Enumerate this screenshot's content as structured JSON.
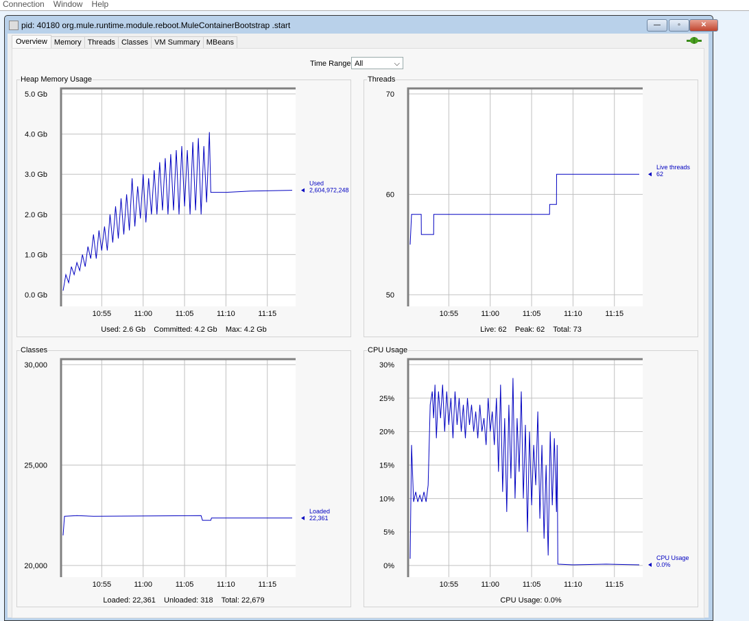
{
  "menu": [
    "Connection",
    "Window",
    "Help"
  ],
  "window": {
    "title": "pid: 40180 org.mule.runtime.module.reboot.MuleContainerBootstrap .start",
    "minimize": "—",
    "maximize": "▫",
    "close": "✕"
  },
  "tabs": [
    "Overview",
    "Memory",
    "Threads",
    "Classes",
    "VM Summary",
    "MBeans"
  ],
  "active_tab": "Overview",
  "time_range": {
    "label": "Time Range:",
    "value": "All"
  },
  "colors": {
    "series": "#0000c0",
    "grid": "#c0c0c0",
    "frame": "#808080"
  },
  "chart_data": [
    {
      "id": "heap",
      "type": "line",
      "title": "Heap Memory Usage",
      "ylim": [
        0,
        5
      ],
      "yticks": [
        0,
        1,
        2,
        3,
        4,
        5
      ],
      "ytick_labels": [
        "0.0 Gb",
        "1.0 Gb",
        "2.0 Gb",
        "3.0 Gb",
        "4.0 Gb",
        "5.0 Gb"
      ],
      "xlim": [
        "10:50:05",
        "11:18:25"
      ],
      "xtick_labels": [
        "10:55",
        "11:00",
        "11:05",
        "11:10",
        "11:15"
      ],
      "grid": true,
      "legend": {
        "label": "Used",
        "value": "2,604,972,248"
      },
      "footer": "Used: 2.6 Gb    Committed: 4.2 Gb    Max: 4.2 Gb",
      "points": [
        [
          "10:50:20",
          0.1
        ],
        [
          "10:50:40",
          0.5
        ],
        [
          "10:51:00",
          0.3
        ],
        [
          "10:51:20",
          0.7
        ],
        [
          "10:51:40",
          0.5
        ],
        [
          "10:52:00",
          0.8
        ],
        [
          "10:52:20",
          0.6
        ],
        [
          "10:52:40",
          1.0
        ],
        [
          "10:53:00",
          0.7
        ],
        [
          "10:53:20",
          1.2
        ],
        [
          "10:53:40",
          0.9
        ],
        [
          "10:54:00",
          1.5
        ],
        [
          "10:54:20",
          0.9
        ],
        [
          "10:54:40",
          1.6
        ],
        [
          "10:55:00",
          1.1
        ],
        [
          "10:55:20",
          1.7
        ],
        [
          "10:55:40",
          1.1
        ],
        [
          "10:56:00",
          2.0
        ],
        [
          "10:56:20",
          1.3
        ],
        [
          "10:56:40",
          2.2
        ],
        [
          "10:57:00",
          1.4
        ],
        [
          "10:57:20",
          2.4
        ],
        [
          "10:57:40",
          1.5
        ],
        [
          "10:58:00",
          2.5
        ],
        [
          "10:58:20",
          1.6
        ],
        [
          "10:58:40",
          2.9
        ],
        [
          "10:59:00",
          1.7
        ],
        [
          "10:59:20",
          2.7
        ],
        [
          "10:59:40",
          1.9
        ],
        [
          "11:00:00",
          3.0
        ],
        [
          "11:00:20",
          1.8
        ],
        [
          "11:00:40",
          2.9
        ],
        [
          "11:01:00",
          2.0
        ],
        [
          "11:01:20",
          3.1
        ],
        [
          "11:01:40",
          2.0
        ],
        [
          "11:02:00",
          3.3
        ],
        [
          "11:02:20",
          2.1
        ],
        [
          "11:02:40",
          3.4
        ],
        [
          "11:03:00",
          2.0
        ],
        [
          "11:03:20",
          3.5
        ],
        [
          "11:03:40",
          2.1
        ],
        [
          "11:04:00",
          3.6
        ],
        [
          "11:04:20",
          2.0
        ],
        [
          "11:04:40",
          3.7
        ],
        [
          "11:05:00",
          2.2
        ],
        [
          "11:05:20",
          3.6
        ],
        [
          "11:05:40",
          2.0
        ],
        [
          "11:06:00",
          3.8
        ],
        [
          "11:06:20",
          2.1
        ],
        [
          "11:06:40",
          3.9
        ],
        [
          "11:07:00",
          2.0
        ],
        [
          "11:07:20",
          3.7
        ],
        [
          "11:07:40",
          2.3
        ],
        [
          "11:08:00",
          4.05
        ],
        [
          "11:08:10",
          2.55
        ],
        [
          "11:10:00",
          2.55
        ],
        [
          "11:13:00",
          2.58
        ],
        [
          "11:18:00",
          2.6
        ]
      ]
    },
    {
      "id": "threads",
      "type": "line",
      "title": "Threads",
      "ylim": [
        50,
        70
      ],
      "yticks": [
        50,
        60,
        70
      ],
      "ytick_labels": [
        "50",
        "60",
        "70"
      ],
      "xlim": [
        "10:50:05",
        "11:18:25"
      ],
      "xtick_labels": [
        "10:55",
        "11:00",
        "11:05",
        "11:10",
        "11:15"
      ],
      "grid": true,
      "legend": {
        "label": "Live threads",
        "value": "62"
      },
      "footer": "Live: 62    Peak: 62    Total: 73",
      "points": [
        [
          "10:50:20",
          55
        ],
        [
          "10:50:30",
          58
        ],
        [
          "10:51:40",
          58
        ],
        [
          "10:51:41",
          56
        ],
        [
          "10:53:10",
          56
        ],
        [
          "10:53:11",
          58
        ],
        [
          "11:07:10",
          58
        ],
        [
          "11:07:11",
          59
        ],
        [
          "11:08:00",
          59
        ],
        [
          "11:08:01",
          62
        ],
        [
          "11:18:00",
          62
        ]
      ]
    },
    {
      "id": "classes",
      "type": "line",
      "title": "Classes",
      "ylim": [
        20000,
        30000
      ],
      "yticks": [
        20000,
        25000,
        30000
      ],
      "ytick_labels": [
        "20,000",
        "25,000",
        "30,000"
      ],
      "xlim": [
        "10:50:05",
        "11:18:25"
      ],
      "xtick_labels": [
        "10:55",
        "11:00",
        "11:05",
        "11:10",
        "11:15"
      ],
      "grid": true,
      "legend": {
        "label": "Loaded",
        "value": "22,361"
      },
      "footer": "Loaded: 22,361    Unloaded: 318    Total: 22,679",
      "points": [
        [
          "10:50:20",
          21500
        ],
        [
          "10:50:30",
          22450
        ],
        [
          "10:52:00",
          22480
        ],
        [
          "10:54:00",
          22450
        ],
        [
          "11:07:00",
          22480
        ],
        [
          "11:07:10",
          22250
        ],
        [
          "11:08:10",
          22250
        ],
        [
          "11:08:15",
          22361
        ],
        [
          "11:18:00",
          22361
        ]
      ]
    },
    {
      "id": "cpu",
      "type": "line",
      "title": "CPU Usage",
      "ylim": [
        0,
        30
      ],
      "yticks": [
        0,
        5,
        10,
        15,
        20,
        25,
        30
      ],
      "ytick_labels": [
        "0%",
        "5%",
        "10%",
        "15%",
        "20%",
        "25%",
        "30%"
      ],
      "xlim": [
        "10:50:05",
        "11:18:25"
      ],
      "xtick_labels": [
        "10:55",
        "11:00",
        "11:05",
        "11:10",
        "11:15"
      ],
      "grid": true,
      "legend": {
        "label": "CPU Usage",
        "value": "0.0%"
      },
      "footer": "CPU Usage: 0.0%",
      "points": [
        [
          "10:50:20",
          1
        ],
        [
          "10:50:30",
          18
        ],
        [
          "10:50:45",
          9.5
        ],
        [
          "10:51:00",
          11
        ],
        [
          "10:51:15",
          9.5
        ],
        [
          "10:51:30",
          10.5
        ],
        [
          "10:51:45",
          9.5
        ],
        [
          "10:52:00",
          11
        ],
        [
          "10:52:15",
          9.5
        ],
        [
          "10:52:30",
          12
        ],
        [
          "10:52:45",
          24
        ],
        [
          "10:53:00",
          26
        ],
        [
          "10:53:10",
          22
        ],
        [
          "10:53:20",
          27
        ],
        [
          "10:53:30",
          19
        ],
        [
          "10:53:45",
          26
        ],
        [
          "10:54:00",
          22
        ],
        [
          "10:54:15",
          27
        ],
        [
          "10:54:30",
          20
        ],
        [
          "10:54:45",
          26
        ],
        [
          "10:55:00",
          21
        ],
        [
          "10:55:15",
          25
        ],
        [
          "10:55:30",
          19
        ],
        [
          "10:55:45",
          26
        ],
        [
          "10:56:00",
          21
        ],
        [
          "10:56:15",
          25
        ],
        [
          "10:56:30",
          20
        ],
        [
          "10:56:45",
          24
        ],
        [
          "10:57:00",
          19
        ],
        [
          "10:57:15",
          25
        ],
        [
          "10:57:30",
          21
        ],
        [
          "10:57:45",
          24
        ],
        [
          "10:58:00",
          20
        ],
        [
          "10:58:15",
          23
        ],
        [
          "10:58:30",
          19
        ],
        [
          "10:58:45",
          24
        ],
        [
          "10:59:00",
          20
        ],
        [
          "10:59:15",
          22
        ],
        [
          "10:59:30",
          18
        ],
        [
          "10:59:45",
          25
        ],
        [
          "11:00:00",
          20
        ],
        [
          "11:00:15",
          23
        ],
        [
          "11:00:30",
          18
        ],
        [
          "11:00:45",
          25
        ],
        [
          "11:01:00",
          14
        ],
        [
          "11:01:15",
          27
        ],
        [
          "11:01:30",
          11
        ],
        [
          "11:01:45",
          22
        ],
        [
          "11:02:00",
          8
        ],
        [
          "11:02:15",
          24
        ],
        [
          "11:02:30",
          13
        ],
        [
          "11:02:45",
          28
        ],
        [
          "11:03:00",
          10
        ],
        [
          "11:03:15",
          22
        ],
        [
          "11:03:30",
          14
        ],
        [
          "11:03:45",
          26
        ],
        [
          "11:04:00",
          10
        ],
        [
          "11:04:15",
          21
        ],
        [
          "11:04:30",
          5
        ],
        [
          "11:04:45",
          20
        ],
        [
          "11:05:00",
          9
        ],
        [
          "11:05:15",
          18
        ],
        [
          "11:05:30",
          12
        ],
        [
          "11:05:45",
          23
        ],
        [
          "11:06:00",
          7
        ],
        [
          "11:06:15",
          18
        ],
        [
          "11:06:30",
          4
        ],
        [
          "11:06:45",
          15
        ],
        [
          "11:07:00",
          1.5
        ],
        [
          "11:07:15",
          20
        ],
        [
          "11:07:30",
          9
        ],
        [
          "11:07:45",
          19
        ],
        [
          "11:08:00",
          8
        ],
        [
          "11:08:05",
          18
        ],
        [
          "11:08:10",
          0.2
        ],
        [
          "11:10:00",
          0.1
        ],
        [
          "11:14:00",
          0.2
        ],
        [
          "11:18:00",
          0.1
        ]
      ]
    }
  ]
}
